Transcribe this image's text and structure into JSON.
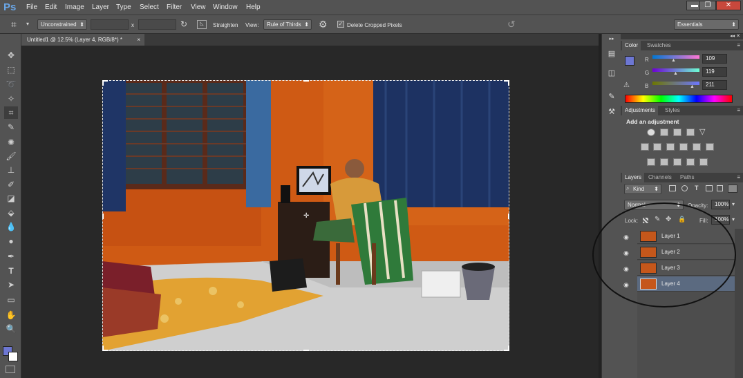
{
  "app": {
    "logo": "Ps"
  },
  "menu": [
    "File",
    "Edit",
    "Image",
    "Layer",
    "Type",
    "Select",
    "Filter",
    "View",
    "Window",
    "Help"
  ],
  "window_controls": {
    "minimize": "▬",
    "restore": "❐",
    "close": "✕"
  },
  "options": {
    "crop_ratio": "Unconstrained",
    "swap_symbol": "x",
    "straighten_label": "Straighten",
    "view_label": "View:",
    "view_value": "Rule of Thirds",
    "delete_cropped": "Delete Cropped Pixels",
    "workspace": "Essentials"
  },
  "document": {
    "tab_title": "Untitled1 @ 12.5% (Layer 4, RGB/8*) *",
    "close": "×"
  },
  "color_panel": {
    "tabs": [
      "Color",
      "Swatches"
    ],
    "channels": [
      {
        "label": "R",
        "value": "109"
      },
      {
        "label": "G",
        "value": "119"
      },
      {
        "label": "B",
        "value": "211"
      }
    ],
    "foreground": "#6d77d3",
    "background": "#ffffff"
  },
  "adjustments_panel": {
    "tabs": [
      "Adjustments",
      "Styles"
    ],
    "heading": "Add an adjustment"
  },
  "layers_panel": {
    "tabs": [
      "Layers",
      "Channels",
      "Paths"
    ],
    "filter_kind": "Kind",
    "blend_mode": "Normal",
    "opacity_label": "Opacity:",
    "opacity_value": "100%",
    "lock_label": "Lock:",
    "fill_label": "Fill:",
    "fill_value": "100%",
    "layers": [
      {
        "name": "Layer 1",
        "selected": false
      },
      {
        "name": "Layer 2",
        "selected": false
      },
      {
        "name": "Layer 3",
        "selected": false
      },
      {
        "name": "Layer 4",
        "selected": true
      }
    ]
  },
  "colors": {
    "accent": "#6aa7e8",
    "selection": "#5b6a80",
    "photo_wall": "#d45d16",
    "curtain": "#1f3566"
  }
}
